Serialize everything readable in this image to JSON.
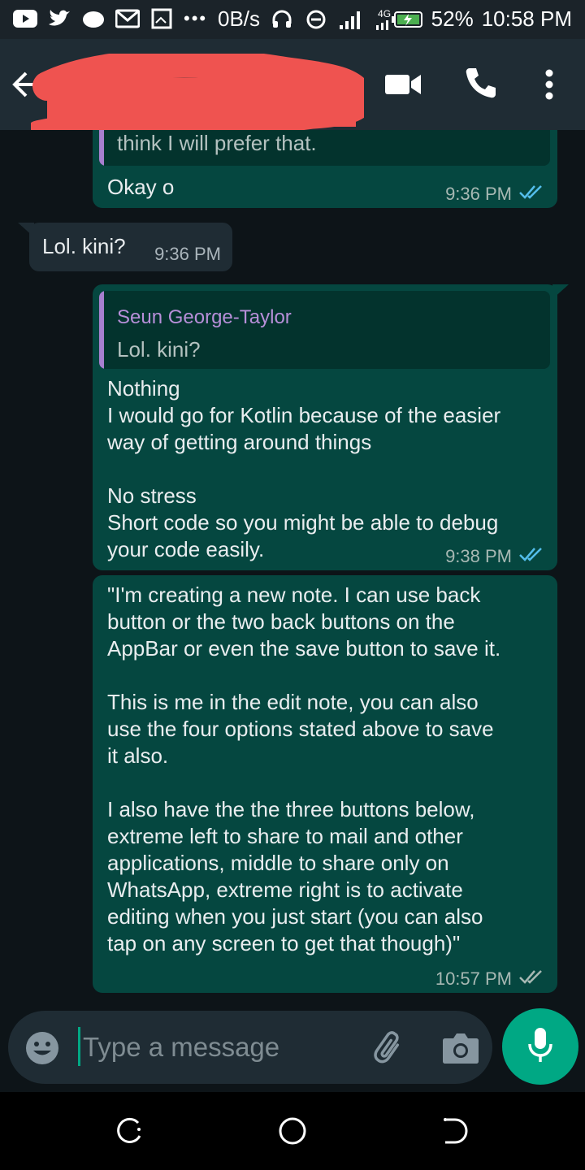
{
  "status_bar": {
    "net_speed": "0B/s",
    "network_label": "4G",
    "battery": "52%",
    "time": "10:58 PM",
    "more_notifications": "•••"
  },
  "app_bar": {
    "contact_name": "",
    "icons": [
      "back-arrow-icon",
      "video-call-icon",
      "voice-call-icon",
      "more-options-icon"
    ]
  },
  "messages": [
    {
      "direction": "outgoing",
      "quote_text": "think I will prefer that.",
      "text": "Okay o",
      "time": "9:36 PM",
      "status": "read"
    },
    {
      "direction": "incoming",
      "text": "Lol. kini?",
      "time": "9:36 PM"
    },
    {
      "direction": "outgoing",
      "quote_name": "Seun George-Taylor",
      "quote_text": "Lol. kini?",
      "text": "Nothing\nI would go for Kotlin because of the easier\nway of getting around things\n\nNo stress\nShort code so you might be able to debug\nyour code easily.",
      "time": "9:38 PM",
      "status": "read"
    },
    {
      "direction": "outgoing",
      "text": "\"I'm creating a new note. I can use back\nbutton or the two back buttons on the\nAppBar or even the save button to save it.\n\nThis is me in the edit note, you can also\nuse the four options stated above to save\nit also.\n\nI also have the the three buttons below,\nextreme left to share to mail and other\napplications, middle to share only on\nWhatsApp, extreme right is to activate\nediting when you just start (you can also\ntap on any screen to get that though)\"",
      "time": "10:57 PM",
      "status": "delivered"
    }
  ],
  "composer": {
    "placeholder": "Type a message",
    "value": ""
  },
  "colors": {
    "outgoing_bubble": "#054740",
    "incoming_bubble": "#1f2c34",
    "accent": "#00a884",
    "read_tick": "#53bdeb",
    "quote_author": "#b78fd9"
  }
}
